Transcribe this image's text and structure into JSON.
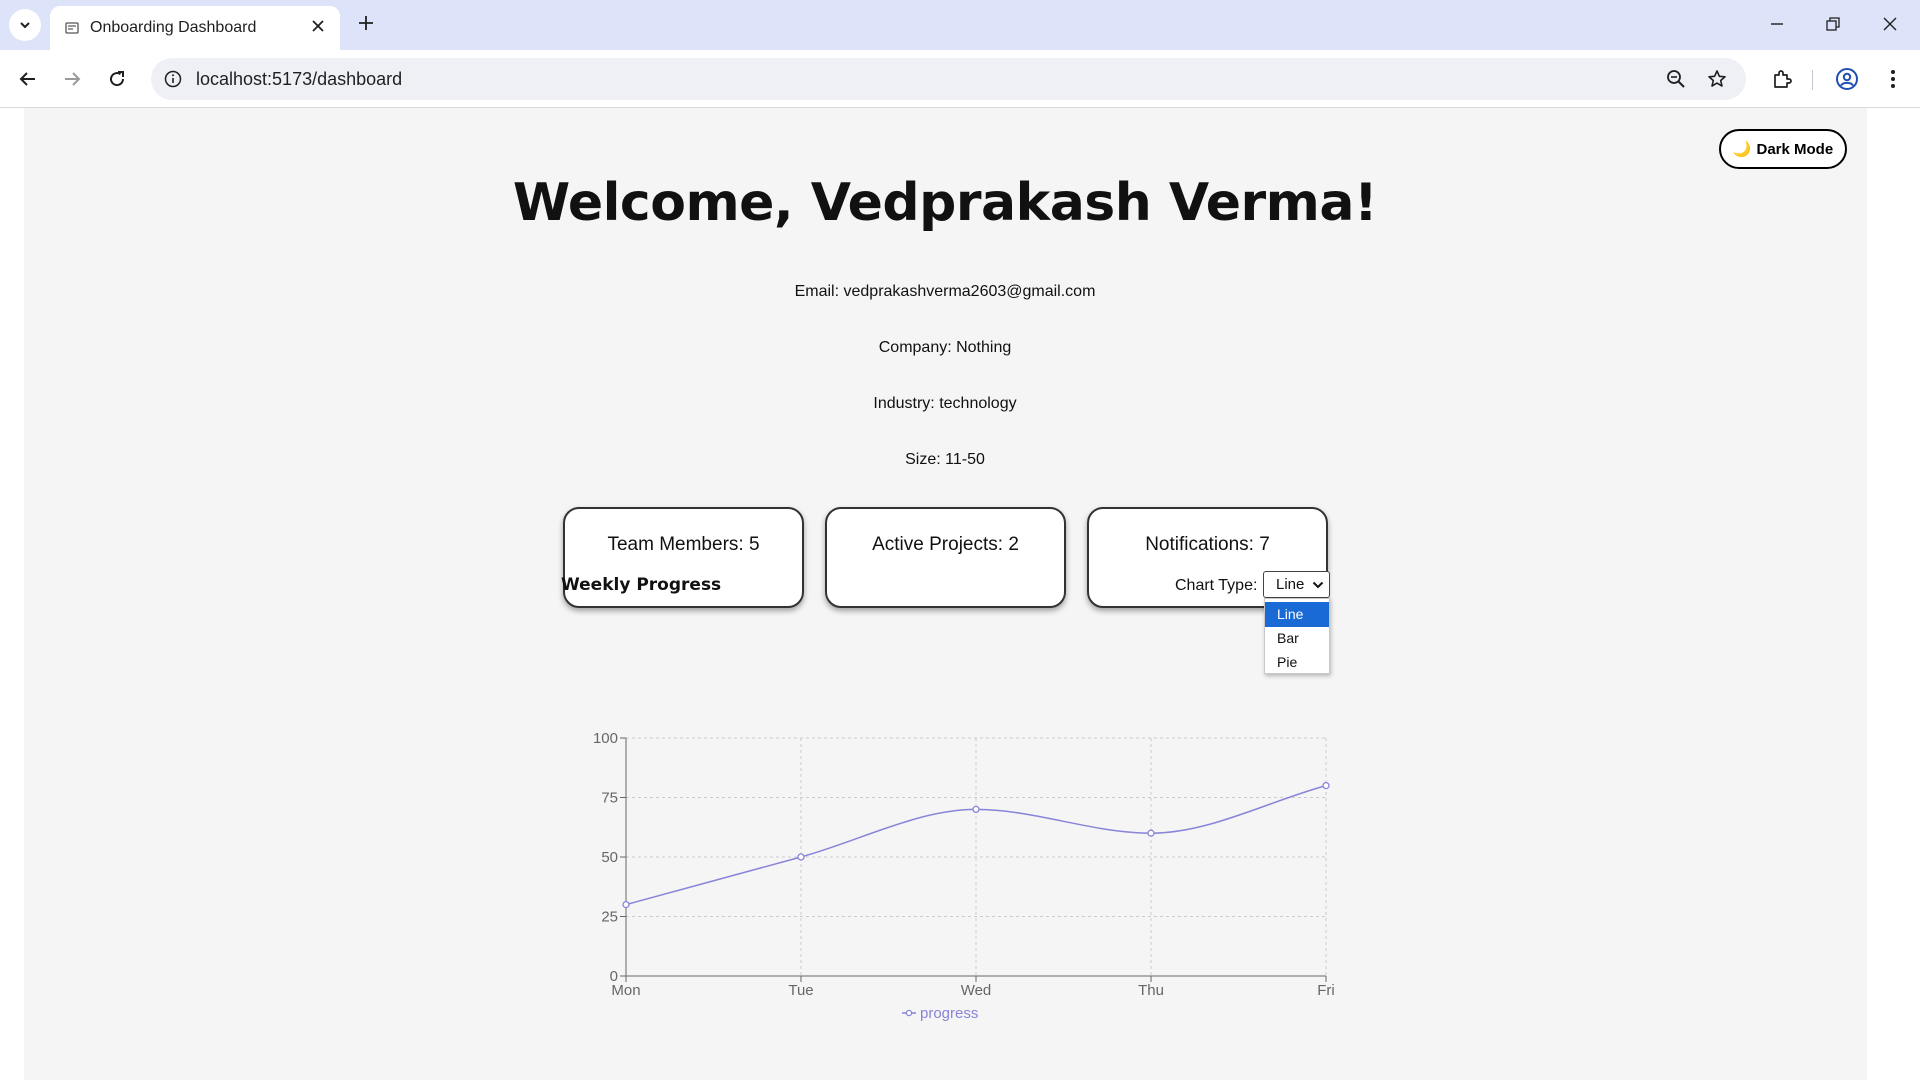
{
  "browser": {
    "tab_title": "Onboarding Dashboard",
    "url": "localhost:5173/dashboard"
  },
  "page": {
    "dark_mode_label": "Dark Mode",
    "dark_mode_icon": "🌙",
    "welcome": "Welcome, Vedprakash Verma!",
    "email_line": "Email: vedprakashverma2603@gmail.com",
    "company_line": "Company: Nothing",
    "industry_line": "Industry: technology",
    "size_line": "Size: 11-50",
    "cards": [
      {
        "label": "Team Members: 5"
      },
      {
        "label": "Active Projects: 2"
      },
      {
        "label": "Notifications: 7"
      }
    ],
    "chart_section_title": "Weekly Progress",
    "chart_type_label": "Chart Type:",
    "chart_type_selected": "Line",
    "chart_type_options": [
      "Line",
      "Bar",
      "Pie"
    ]
  },
  "colors": {
    "series": "#8884d8",
    "selected_option": "#1a6ad6",
    "grid": "#cccccc",
    "axis": "#666666"
  },
  "chart_data": {
    "type": "line",
    "x": [
      "Mon",
      "Tue",
      "Wed",
      "Thu",
      "Fri"
    ],
    "series": [
      {
        "name": "progress",
        "values": [
          30,
          50,
          70,
          60,
          80
        ]
      }
    ],
    "yticks": [
      0,
      25,
      50,
      75,
      100
    ],
    "ylim": [
      0,
      100
    ],
    "grid": true,
    "legend": "bottom-center"
  }
}
